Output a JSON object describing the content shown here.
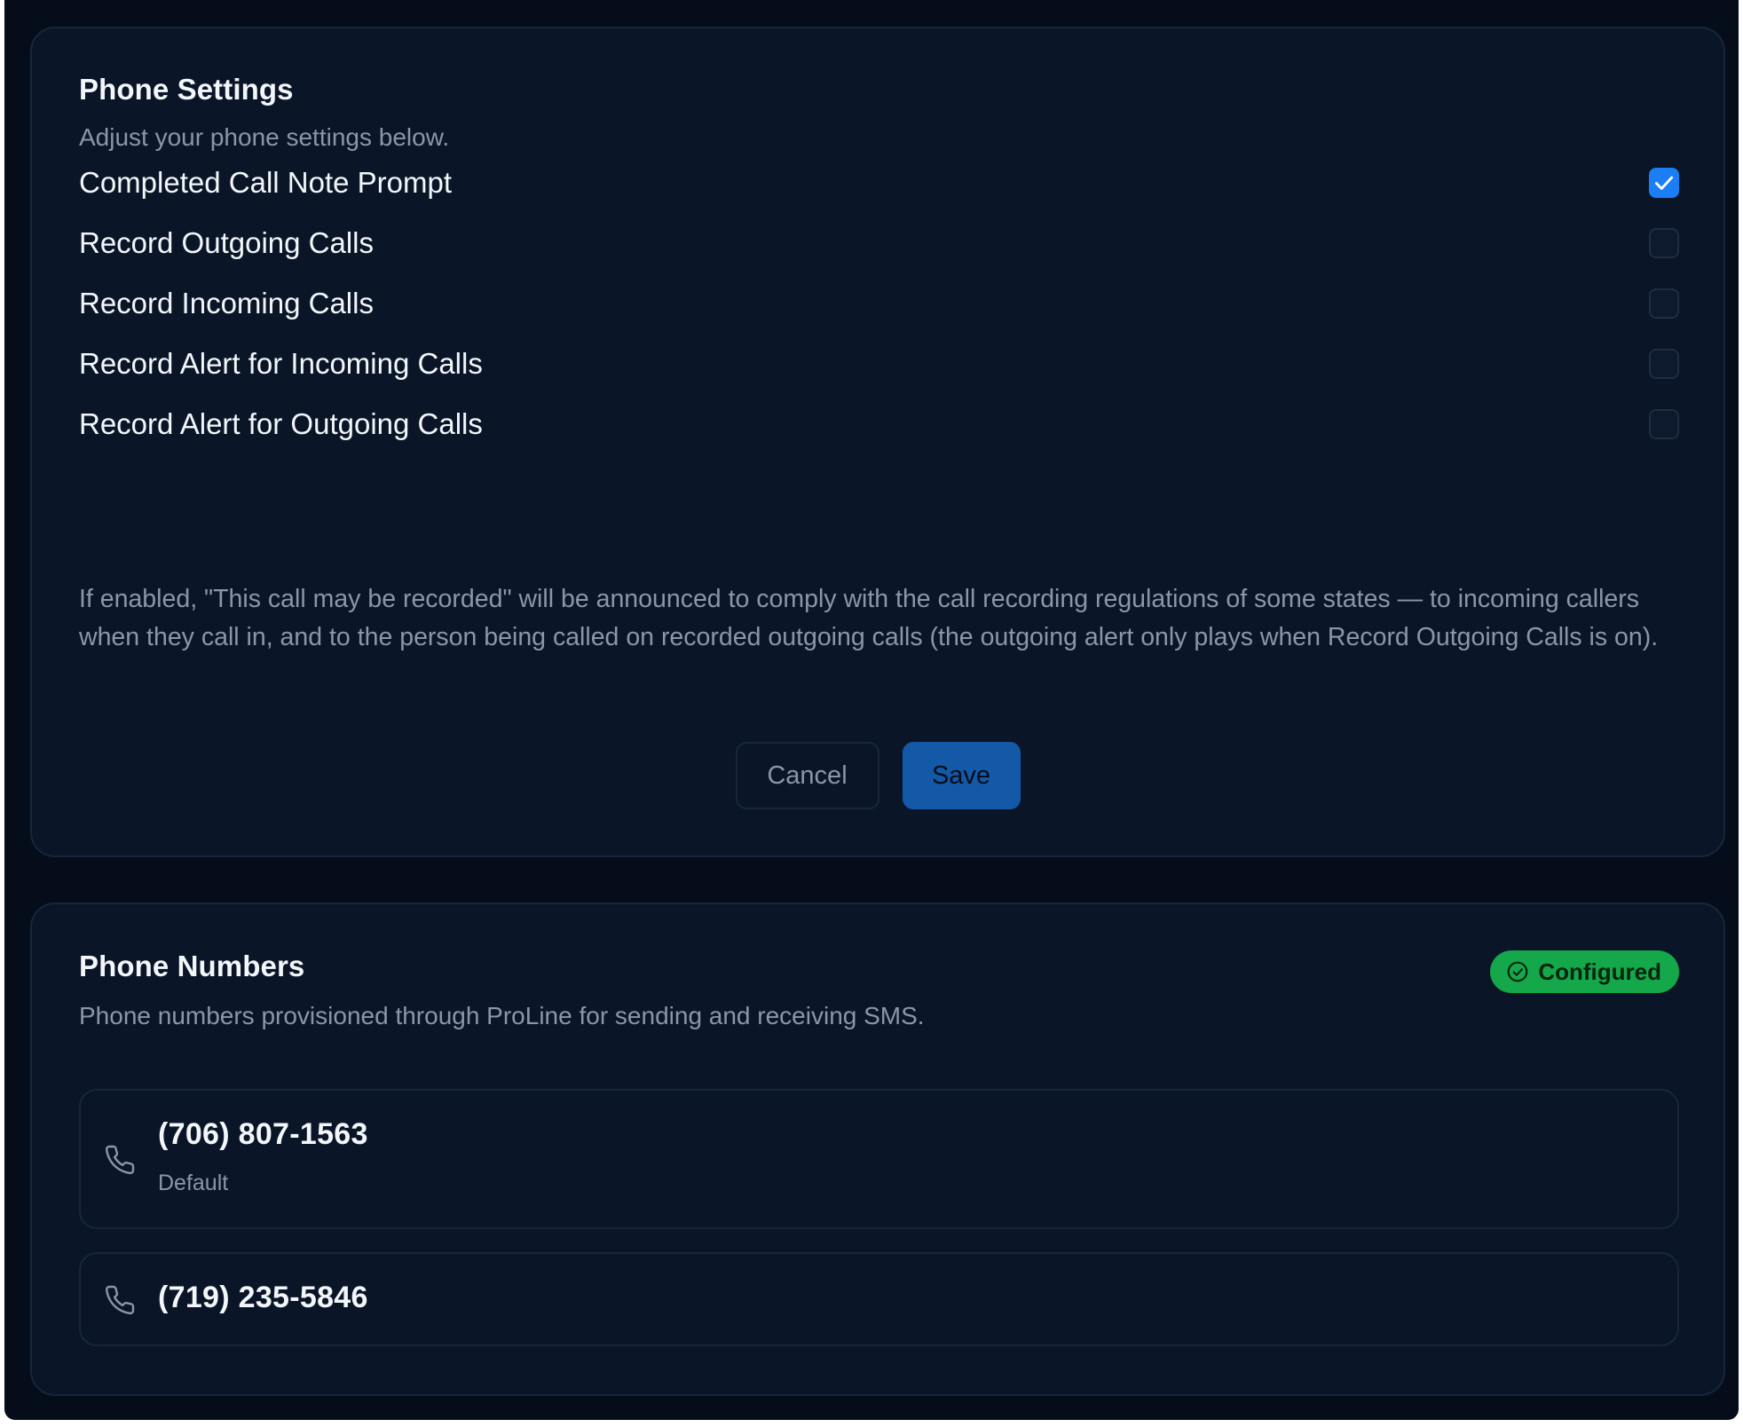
{
  "settings": {
    "title": "Phone Settings",
    "subtitle": "Adjust your phone settings below.",
    "options": [
      {
        "label": "Completed Call Note Prompt",
        "checked": true
      },
      {
        "label": "Record Outgoing Calls",
        "checked": false
      },
      {
        "label": "Record Incoming Calls",
        "checked": false
      },
      {
        "label": "Record Alert for Incoming Calls",
        "checked": false
      },
      {
        "label": "Record Alert for Outgoing Calls",
        "checked": false
      }
    ],
    "help_text": "If enabled, \"This call may be recorded\" will be announced to comply with the call recording regulations of some states — to incoming callers when they call in, and to the person being called on recorded outgoing calls (the outgoing alert only plays when Record Outgoing Calls is on).",
    "cancel_label": "Cancel",
    "save_label": "Save"
  },
  "numbers": {
    "title": "Phone Numbers",
    "subtitle": "Phone numbers provisioned through ProLine for sending and receiving SMS.",
    "status_badge": "Configured",
    "items": [
      {
        "number": "(706) 807-1563",
        "tag": "Default"
      },
      {
        "number": "(719) 235-5846"
      }
    ]
  },
  "colors": {
    "background": "#050d1a",
    "card": "#0a1628",
    "accent": "#1a7ef5",
    "save_button": "#1458a8",
    "badge": "#14a84a"
  },
  "icons": {
    "checkbox_check": "check-icon",
    "badge": "check-circle-icon",
    "number": "phone-icon"
  }
}
